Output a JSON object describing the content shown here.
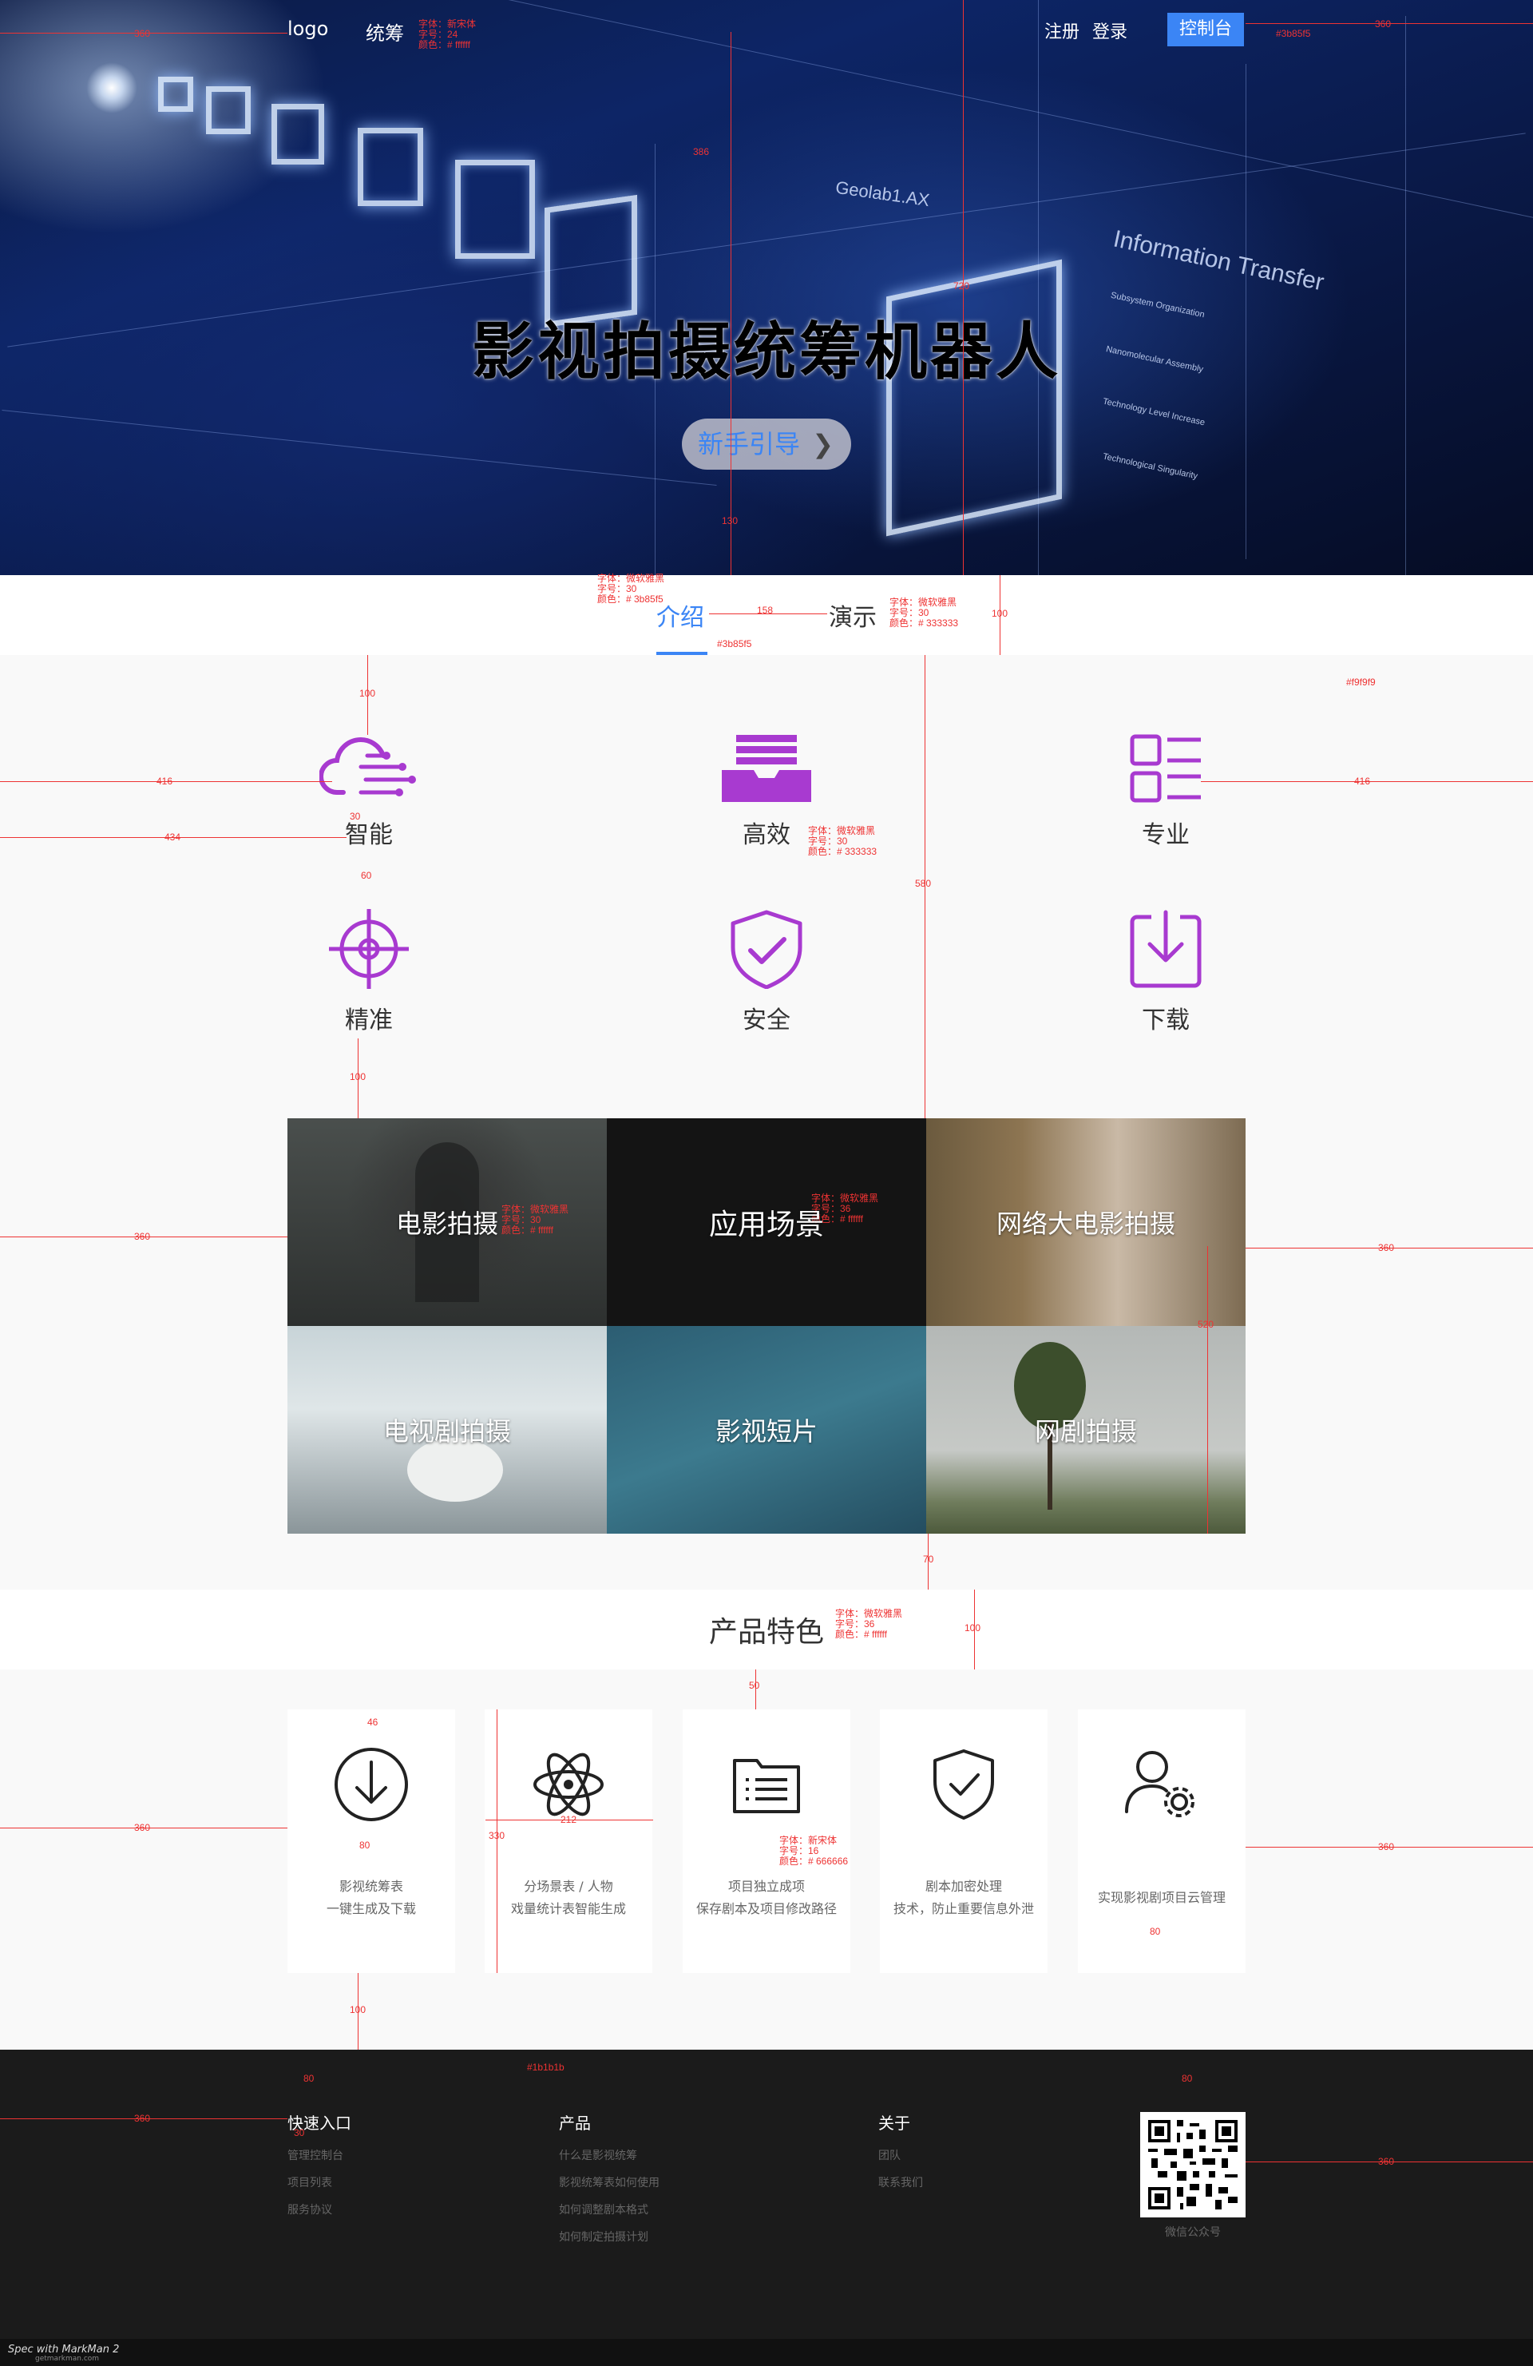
{
  "nav": {
    "logo": "logo",
    "tongchou": "统筹",
    "register": "注册",
    "login": "登录",
    "console": "控制台"
  },
  "hero": {
    "title": "影视拍摄统筹机器人",
    "guide_button": "新手引导",
    "deco": {
      "code": "Geolab1.AX",
      "transfer": "Information Transfer",
      "sub1": "Subsystem Organization",
      "sub2": "Nanomolecular Assembly",
      "sub3": "Technology Level Increase",
      "sub4": "Technological Singularity"
    }
  },
  "tabs": {
    "intro": "介绍",
    "demo": "演示"
  },
  "features": [
    {
      "label": "智能",
      "icon": "cloud-circuit-icon"
    },
    {
      "label": "高效",
      "icon": "inbox-stack-icon"
    },
    {
      "label": "专业",
      "icon": "list-icon"
    },
    {
      "label": "精准",
      "icon": "crosshair-icon"
    },
    {
      "label": "安全",
      "icon": "shield-check-icon"
    },
    {
      "label": "下载",
      "icon": "download-icon"
    }
  ],
  "scenes": [
    "电影拍摄",
    "应用场景",
    "网络大电影拍摄",
    "电视剧拍摄",
    "影视短片",
    "网剧拍摄"
  ],
  "product_features": {
    "title": "产品特色",
    "cards": [
      {
        "line1": "影视统筹表",
        "line2": "一键生成及下载",
        "icon": "download-circle-icon"
      },
      {
        "line1": "分场景表 / 人物",
        "line2": "戏量统计表智能生成",
        "icon": "atom-icon"
      },
      {
        "line1": "项目独立成项",
        "line2": "保存剧本及项目修改路径",
        "icon": "document-list-icon"
      },
      {
        "line1": "剧本加密处理",
        "line2": "技术，防止重要信息外泄",
        "icon": "shield-check-icon"
      },
      {
        "line1": "实现影视剧项目云管理",
        "line2": "",
        "icon": "user-gear-icon"
      }
    ]
  },
  "footer": {
    "col1": {
      "title": "快速入口",
      "links": [
        "管理控制台",
        "项目列表",
        "服务协议"
      ]
    },
    "col2": {
      "title": "产品",
      "links": [
        "什么是影视统筹",
        "影视统筹表如何使用",
        "如何调整剧本格式",
        "如何制定拍摄计划"
      ]
    },
    "col3": {
      "title": "关于",
      "links": [
        "团队",
        "联系我们"
      ]
    },
    "qr_caption": "微信公众号"
  },
  "colors": {
    "accent": "#3b85f5",
    "feature_purple": "#a83ad0",
    "page_bg": "#f9f9f9",
    "footer_bg": "#1b1b1b",
    "text": "#333333"
  },
  "annotations": {
    "spec_font": "字体：微软雅黑",
    "spec_size30": "字号：30",
    "spec_size36": "字号：36",
    "spec_size16": "字号：16",
    "spec_size24": "字号：24",
    "spec_color_white": "颜色：# ffffff",
    "spec_color_333": "颜色：# 333333",
    "spec_color_666": "颜色：# 666666",
    "spec_color_blue": "颜色：# 3b85f5",
    "spec_font_song": "字体：新宋体",
    "hex_blue": "#3b85f5",
    "hex_bg": "#f9f9f9",
    "hex_footer": "#1b1b1b",
    "hex_nav": "#3b85f5",
    "d360": "360",
    "d416": "416",
    "d434": "434",
    "d100": "100",
    "d30": "30",
    "d60": "60",
    "d580": "580",
    "d70": "70",
    "d720": "720",
    "d386": "386",
    "d130": "130",
    "d158": "158",
    "d50": "50",
    "d46": "46",
    "d80": "80",
    "d212": "212",
    "d330": "330",
    "d520": "520",
    "d64": "64",
    "d4": "4",
    "d20": "20",
    "d36": "36",
    "d96": "96"
  },
  "markman": {
    "title": "Spec with MarkMan 2",
    "url": "getmarkman.com"
  }
}
